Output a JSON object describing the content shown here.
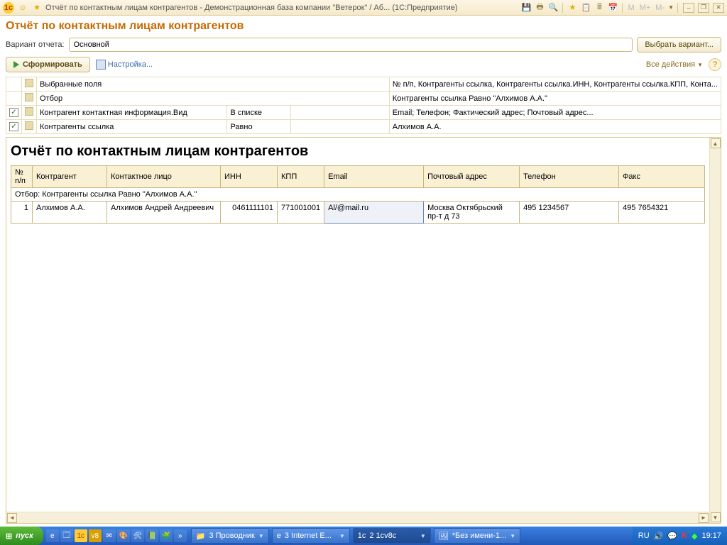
{
  "titlebar": {
    "title": "Отчёт по контактным лицам контрагентов - Демонстрационная база компании \"Ветерок\" / Аб...  (1С:Предприятие)",
    "mem": [
      "M",
      "M+",
      "M-"
    ]
  },
  "page": {
    "title": "Отчёт по контактным лицам контрагентов",
    "variant_label": "Вариант отчета:",
    "variant_value": "Основной",
    "choose_variant": "Выбрать вариант...",
    "run": "Сформировать",
    "settings": "Настройка...",
    "all_actions": "Все действия"
  },
  "settings_rows": [
    {
      "checked": null,
      "name": "Выбранные поля",
      "col2": "",
      "col3": "",
      "col4": "№ п/п, Контрагенты ссылка, Контрагенты ссылка.ИНН, Контрагенты ссылка.КПП, Конта..."
    },
    {
      "checked": null,
      "name": "Отбор",
      "col2": "",
      "col3": "",
      "col4": "Контрагенты ссылка Равно \"Алхимов А.А.\""
    },
    {
      "checked": true,
      "name": "Контрагент контактная информация.Вид",
      "col2": "В списке",
      "col3": "",
      "col4": "Email; Телефон; Фактический адрес; Почтовый адрес..."
    },
    {
      "checked": true,
      "name": "Контрагенты ссылка",
      "col2": "Равно",
      "col3": "",
      "col4": "Алхимов А.А."
    }
  ],
  "report": {
    "title": "Отчёт по контактным лицам контрагентов",
    "columns": [
      "№ п/п",
      "Контрагент",
      "Контактное лицо",
      "ИНН",
      "КПП",
      "Email",
      "Почтовый адрес",
      "Телефон",
      "Факс"
    ],
    "filter_text": "Отбор: Контрагенты ссылка Равно \"Алхимов А.А.\"",
    "rows": [
      {
        "n": "1",
        "agent": "Алхимов А.А.",
        "contact": "Алхимов Андрей Андреевич",
        "inn": "0461111101",
        "kpp": "771001001",
        "email": "Al/@mail.ru",
        "post": "Москва Октябрьский пр-т д 73",
        "tel": "495 1234567",
        "fax": "495 7654321"
      }
    ]
  },
  "taskbar": {
    "start": "пуск",
    "tasks": [
      {
        "label": "3 Проводник",
        "icon": "📁"
      },
      {
        "label": "3 Internet E...",
        "icon": "e"
      },
      {
        "label": "2 1cv8c",
        "icon": "1c"
      },
      {
        "label": "*Без имени-1...",
        "icon": "🖼"
      }
    ],
    "lang": "RU",
    "clock": "19:17"
  }
}
